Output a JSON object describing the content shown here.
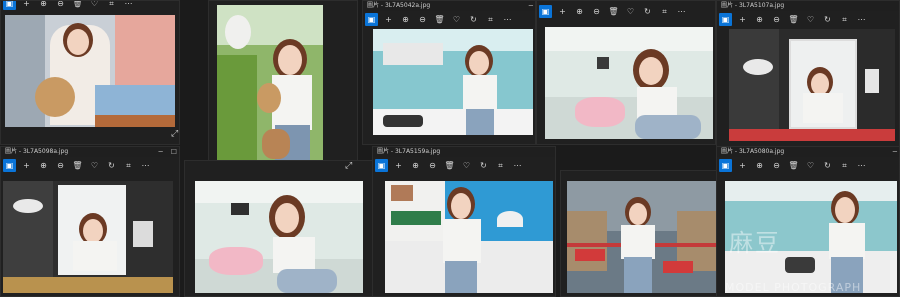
{
  "windows": [
    {
      "title": "",
      "toolbar_icons": [
        "info-icon",
        "add-icon",
        "zoom-in-icon",
        "zoom-out-icon",
        "delete-icon",
        "heart-icon",
        "crop-icon",
        "more-icon"
      ]
    },
    {
      "title": "",
      "toolbar_icons": []
    },
    {
      "title": "圖片 - 3L7A5042a.jpg",
      "toolbar_icons": [
        "info-icon",
        "add-icon",
        "zoom-in-icon",
        "zoom-out-icon",
        "delete-icon",
        "heart-icon",
        "rotate-icon",
        "crop-icon",
        "more-icon"
      ]
    },
    {
      "title": "",
      "toolbar_icons": [
        "info-icon",
        "add-icon",
        "zoom-in-icon",
        "zoom-out-icon",
        "delete-icon",
        "heart-icon",
        "rotate-icon",
        "crop-icon",
        "more-icon"
      ]
    },
    {
      "title": "圖片 - 3L7A5107a.jpg",
      "toolbar_icons": [
        "info-icon",
        "add-icon",
        "zoom-in-icon",
        "zoom-out-icon",
        "delete-icon",
        "heart-icon",
        "rotate-icon",
        "crop-icon",
        "more-icon"
      ]
    },
    {
      "title": "圖片 - 3L7A5098a.jpg",
      "toolbar_icons": [
        "info-icon",
        "add-icon",
        "zoom-in-icon",
        "zoom-out-icon",
        "delete-icon",
        "heart-icon",
        "rotate-icon",
        "crop-icon",
        "more-icon"
      ]
    },
    {
      "title": "",
      "toolbar_icons": []
    },
    {
      "title": "圖片 - 3L7A5159a.jpg",
      "toolbar_icons": [
        "info-icon",
        "add-icon",
        "zoom-in-icon",
        "zoom-out-icon",
        "delete-icon",
        "heart-icon",
        "rotate-icon",
        "crop-icon",
        "more-icon"
      ]
    },
    {
      "title": "",
      "toolbar_icons": []
    },
    {
      "title": "圖片 - 3L7A5080a.jpg",
      "toolbar_icons": [
        "info-icon",
        "add-icon",
        "zoom-in-icon",
        "zoom-out-icon",
        "delete-icon",
        "heart-icon",
        "rotate-icon",
        "crop-icon",
        "more-icon"
      ]
    }
  ],
  "glyphs": {
    "info-icon": "▣",
    "add-icon": "+",
    "zoom-in-icon": "⊕",
    "zoom-out-icon": "⊖",
    "delete-icon": "🗑",
    "heart-icon": "♡",
    "rotate-icon": "↻",
    "crop-icon": "⌗",
    "more-icon": "⋯",
    "expand": "⤢",
    "minimize": "─",
    "maximize": "☐",
    "close": "✕"
  },
  "watermark": {
    "line1": "麻豆",
    "line2": "MODEL PHOTOGRAPH"
  },
  "colors": {
    "accent": "#0a74d8",
    "window_bg": "#202020"
  }
}
